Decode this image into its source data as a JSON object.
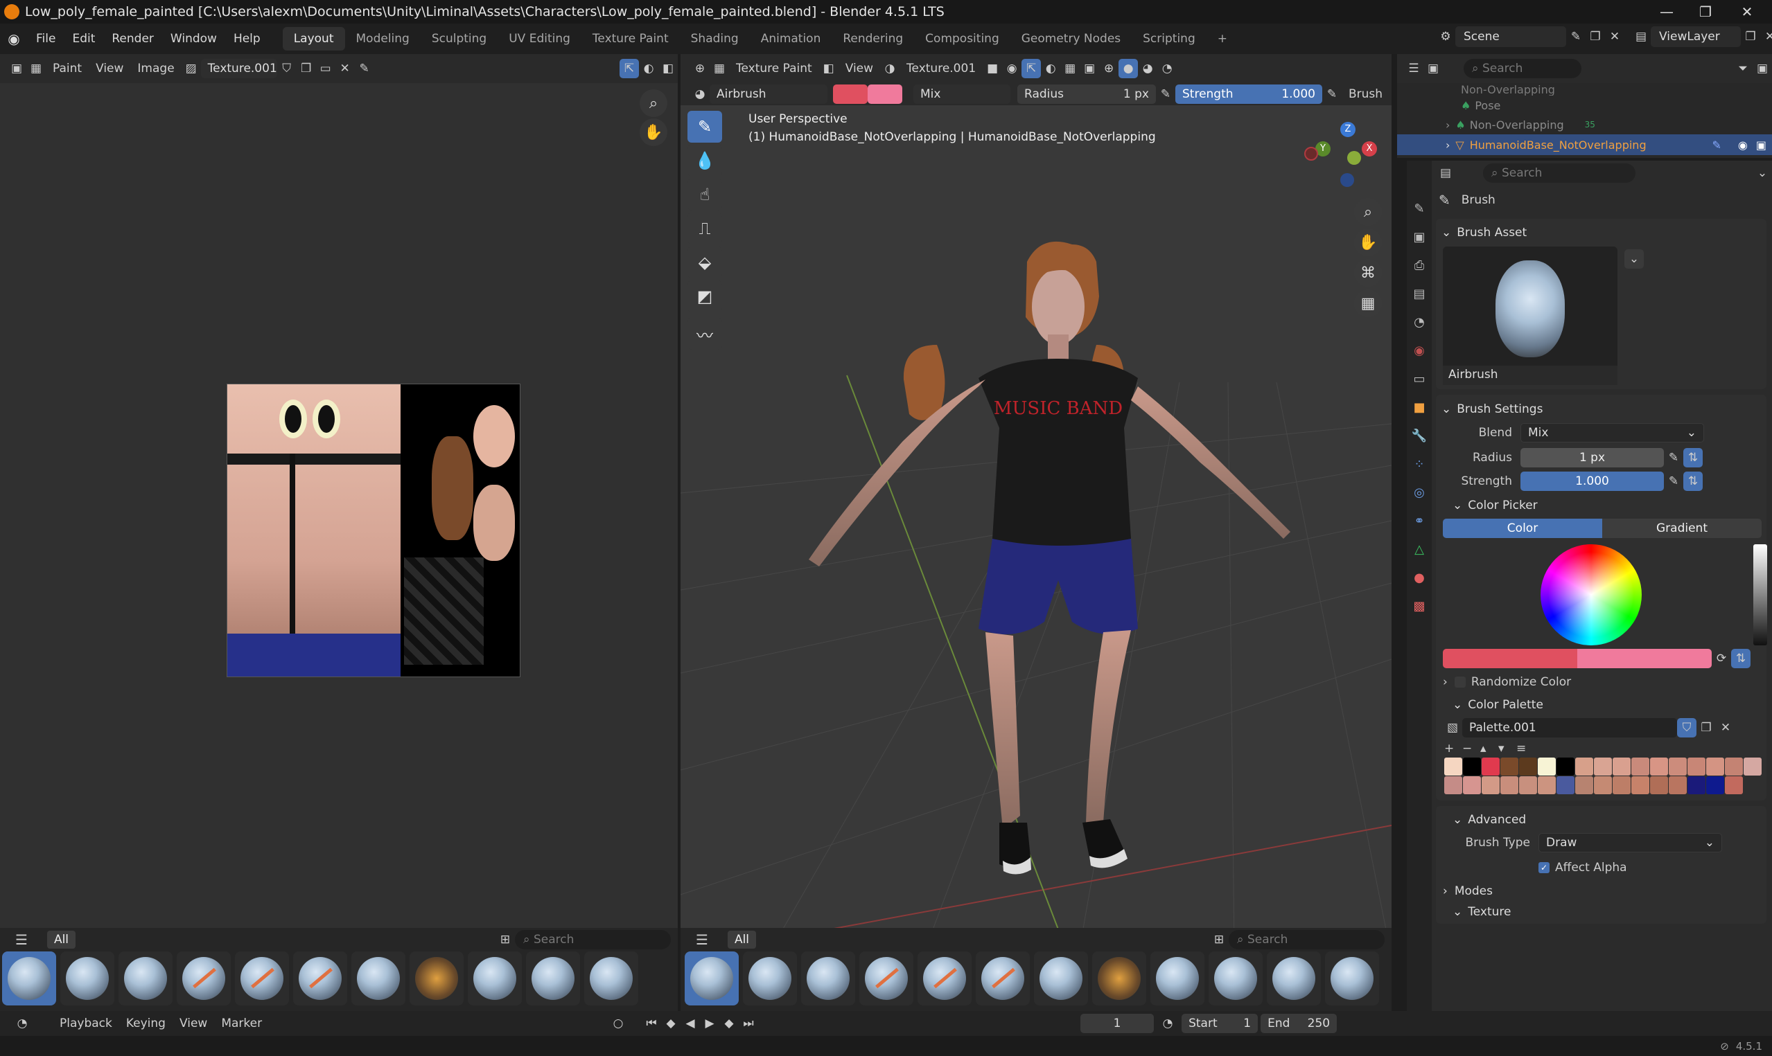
{
  "titlebar": {
    "title": "Low_poly_female_painted [C:\\Users\\alexm\\Documents\\Unity\\Liminal\\Assets\\Characters\\Low_poly_female_painted.blend] - Blender 4.5.1 LTS"
  },
  "menubar": {
    "menus": [
      "File",
      "Edit",
      "Render",
      "Window",
      "Help"
    ],
    "workspaces": [
      "Layout",
      "Modeling",
      "Sculpting",
      "UV Editing",
      "Texture Paint",
      "Shading",
      "Animation",
      "Rendering",
      "Compositing",
      "Geometry Nodes",
      "Scripting"
    ],
    "active_workspace": "Layout",
    "scene": "Scene",
    "view_layer": "ViewLayer"
  },
  "image_editor": {
    "mode": "Paint",
    "menus": [
      "View",
      "Image"
    ],
    "image_name": "Texture.001"
  },
  "viewport": {
    "mode": "Texture Paint",
    "view_menu": "View",
    "texture": "Texture.001",
    "brush": "Airbrush",
    "blend": "Mix",
    "radius_label": "Radius",
    "radius_value": "1 px",
    "strength_label": "Strength",
    "strength_value": "1.000",
    "brush_menu": "Brush",
    "info_line1": "User Perspective",
    "info_line2": "(1) HumanoidBase_NotOverlapping | HumanoidBase_NotOverlapping",
    "shirt_text": "MUSIC BAND",
    "gizmo": {
      "x": "X",
      "y": "Y",
      "z": "Z"
    }
  },
  "outliner": {
    "search_placeholder": "Search",
    "items": [
      "Non-Overlapping",
      "Pose",
      "Non-Overlapping",
      "HumanoidBase_NotOverlapping"
    ],
    "badge": "35"
  },
  "properties": {
    "search_placeholder": "Search",
    "header": "Brush",
    "brush_asset_section": "Brush Asset",
    "brush_asset_name": "Airbrush",
    "brush_settings_section": "Brush Settings",
    "blend_label": "Blend",
    "blend_value": "Mix",
    "radius_label": "Radius",
    "radius_value": "1 px",
    "strength_label": "Strength",
    "strength_value": "1.000",
    "color_picker_section": "Color Picker",
    "color_tab": "Color",
    "gradient_tab": "Gradient",
    "randomize_color": "Randomize Color",
    "color_palette_section": "Color Palette",
    "palette_name": "Palette.001",
    "advanced_section": "Advanced",
    "brush_type_label": "Brush Type",
    "brush_type_value": "Draw",
    "affect_alpha": "Affect Alpha",
    "modes_section": "Modes",
    "texture_section": "Texture",
    "primary_color": "#e05060",
    "secondary_color": "#f07a9c",
    "palette_colors": [
      "#f5d6c1",
      "#000000",
      "#e03a4e",
      "#7a4a2a",
      "#5c3a1e",
      "#f7f3d5",
      "#000000",
      "#d7a08a",
      "#d9a493",
      "#d9a08f",
      "#c98a7b",
      "#d89585",
      "#cc8c7c",
      "#c88676",
      "#d49483",
      "#c48373",
      "#d5a8a2",
      "#c58c87",
      "#d69590",
      "#d39a87",
      "#c98e7c",
      "#c8907e",
      "#cc9480",
      "#4a5a9e",
      "#b78370",
      "#c58a73",
      "#bd7e67",
      "#c7826a",
      "#b06e57",
      "#b97560",
      "#1a1a7a",
      "#0e1a8e",
      "#c26a5e"
    ]
  },
  "shelf_left": {
    "tab": "All",
    "search_placeholder": "Search"
  },
  "shelf_right": {
    "tab": "All",
    "search_placeholder": "Search"
  },
  "timeline": {
    "menus": [
      "Playback",
      "Keying",
      "View",
      "Marker"
    ],
    "current_frame": "1",
    "start_label": "Start",
    "start_value": "1",
    "end_label": "End",
    "end_value": "250"
  },
  "status": {
    "version": "4.5.1"
  }
}
